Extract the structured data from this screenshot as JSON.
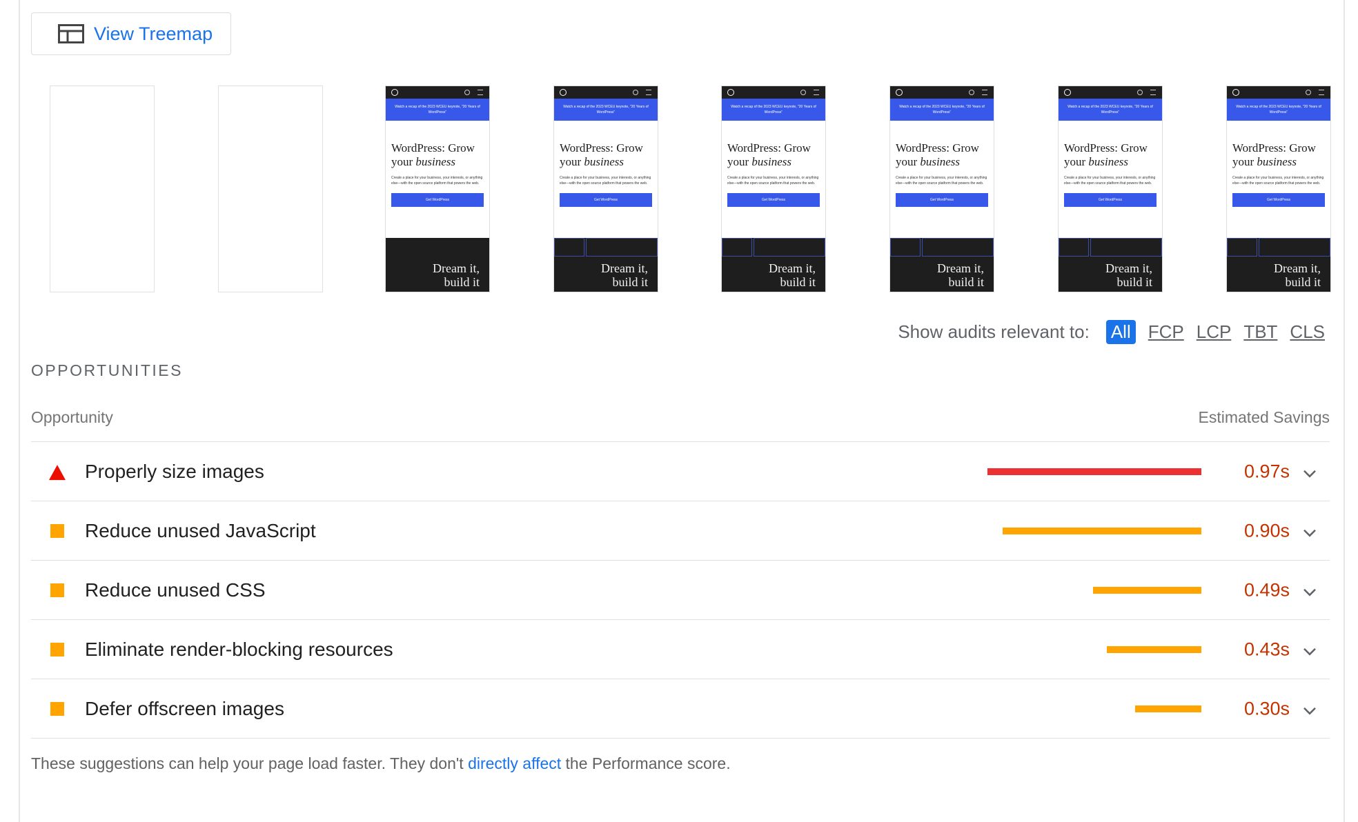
{
  "toolbar": {
    "view_treemap_label": "View Treemap"
  },
  "filmstrip": {
    "thumbnails": [
      {
        "blank": true
      },
      {
        "blank": true
      },
      {
        "blank": false,
        "banner": "Watch a recap of the 2023 WCEU keynote, \"20 Years of WordPress\"",
        "headline": "WordPress: Grow",
        "headline2": "your",
        "headline_italic": "business",
        "paragraph": "Create a place for your business, your interests, or anything else—with the open source platform that powers the web.",
        "button": "Get WordPress",
        "tagline1": "Dream it,",
        "tagline2": "build it",
        "tiles": false
      },
      {
        "blank": false,
        "banner": "Watch a recap of the 2023 WCEU keynote, \"20 Years of WordPress\"",
        "headline": "WordPress: Grow",
        "headline2": "your",
        "headline_italic": "business",
        "paragraph": "Create a place for your business, your interests, or anything else—with the open source platform that powers the web.",
        "button": "Get WordPress",
        "tagline1": "Dream it,",
        "tagline2": "build it",
        "tiles": true
      },
      {
        "blank": false,
        "banner": "Watch a recap of the 2023 WCEU keynote, \"20 Years of WordPress\"",
        "headline": "WordPress: Grow",
        "headline2": "your",
        "headline_italic": "business",
        "paragraph": "Create a place for your business, your interests, or anything else—with the open source platform that powers the web.",
        "button": "Get WordPress",
        "tagline1": "Dream it,",
        "tagline2": "build it",
        "tiles": true
      },
      {
        "blank": false,
        "banner": "Watch a recap of the 2023 WCEU keynote, \"20 Years of WordPress\"",
        "headline": "WordPress: Grow",
        "headline2": "your",
        "headline_italic": "business",
        "paragraph": "Create a place for your business, your interests, or anything else—with the open source platform that powers the web.",
        "button": "Get WordPress",
        "tagline1": "Dream it,",
        "tagline2": "build it",
        "tiles": true
      },
      {
        "blank": false,
        "banner": "Watch a recap of the 2023 WCEU keynote, \"20 Years of WordPress\"",
        "headline": "WordPress: Grow",
        "headline2": "your",
        "headline_italic": "business",
        "paragraph": "Create a place for your business, your interests, or anything else—with the open source platform that powers the web.",
        "button": "Get WordPress",
        "tagline1": "Dream it,",
        "tagline2": "build it",
        "tiles": true
      },
      {
        "blank": false,
        "banner": "Watch a recap of the 2023 WCEU keynote, \"20 Years of WordPress\"",
        "headline": "WordPress: Grow",
        "headline2": "your",
        "headline_italic": "business",
        "paragraph": "Create a place for your business, your interests, or anything else—with the open source platform that powers the web.",
        "button": "Get WordPress",
        "tagline1": "Dream it,",
        "tagline2": "build it",
        "tiles": true
      }
    ]
  },
  "filters": {
    "label": "Show audits relevant to:",
    "options": [
      "All",
      "FCP",
      "LCP",
      "TBT",
      "CLS"
    ],
    "active": "All"
  },
  "opportunities": {
    "section_title": "OPPORTUNITIES",
    "column_left": "Opportunity",
    "column_right": "Estimated Savings",
    "items": [
      {
        "title": "Properly size images",
        "savings": "0.97s",
        "savings_seconds": 0.97,
        "severity": "fail",
        "icon": "red-triangle-icon"
      },
      {
        "title": "Reduce unused JavaScript",
        "savings": "0.90s",
        "savings_seconds": 0.9,
        "severity": "average",
        "icon": "orange-square-icon"
      },
      {
        "title": "Reduce unused CSS",
        "savings": "0.49s",
        "savings_seconds": 0.49,
        "severity": "average",
        "icon": "orange-square-icon"
      },
      {
        "title": "Eliminate render-blocking resources",
        "savings": "0.43s",
        "savings_seconds": 0.43,
        "severity": "average",
        "icon": "orange-square-icon"
      },
      {
        "title": "Defer offscreen images",
        "savings": "0.30s",
        "savings_seconds": 0.3,
        "severity": "average",
        "icon": "orange-square-icon"
      }
    ]
  },
  "footnote": {
    "before": "These suggestions can help your page load faster. They don't ",
    "link": "directly affect",
    "after": " the Performance score."
  },
  "colors": {
    "accent": "#1a73e8",
    "fail": "#eb0f00",
    "average": "#ffa400",
    "savings_text": "#c33300"
  }
}
